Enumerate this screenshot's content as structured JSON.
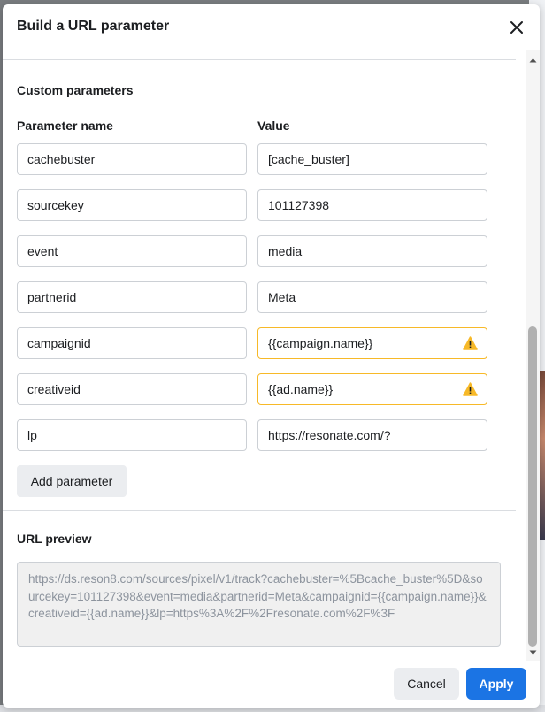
{
  "dialog": {
    "title": "Build a URL parameter",
    "close_icon": "close-icon"
  },
  "custom_parameters": {
    "section_title": "Custom parameters",
    "name_header": "Parameter name",
    "value_header": "Value",
    "rows": [
      {
        "name": "cachebuster",
        "value": "[cache_buster]",
        "warning": false
      },
      {
        "name": "sourcekey",
        "value": "101127398",
        "warning": false
      },
      {
        "name": "event",
        "value": "media",
        "warning": false
      },
      {
        "name": "partnerid",
        "value": "Meta",
        "warning": false
      },
      {
        "name": "campaignid",
        "value": "{{campaign.name}}",
        "warning": true
      },
      {
        "name": "creativeid",
        "value": "{{ad.name}}",
        "warning": true
      },
      {
        "name": "lp",
        "value": "https://resonate.com/?",
        "warning": false
      }
    ],
    "add_button": "Add parameter"
  },
  "url_preview": {
    "title": "URL preview",
    "text": "https://ds.reson8.com/sources/pixel/v1/track?cachebuster=%5Bcache_buster%5D&sourcekey=101127398&event=media&partnerid=Meta&campaignid={{campaign.name}}&creativeid={{ad.name}}&lp=https%3A%2F%2Fresonate.com%2F%3F"
  },
  "footer": {
    "cancel": "Cancel",
    "apply": "Apply"
  },
  "colors": {
    "primary": "#1b74e4",
    "warning": "#f7b928"
  }
}
